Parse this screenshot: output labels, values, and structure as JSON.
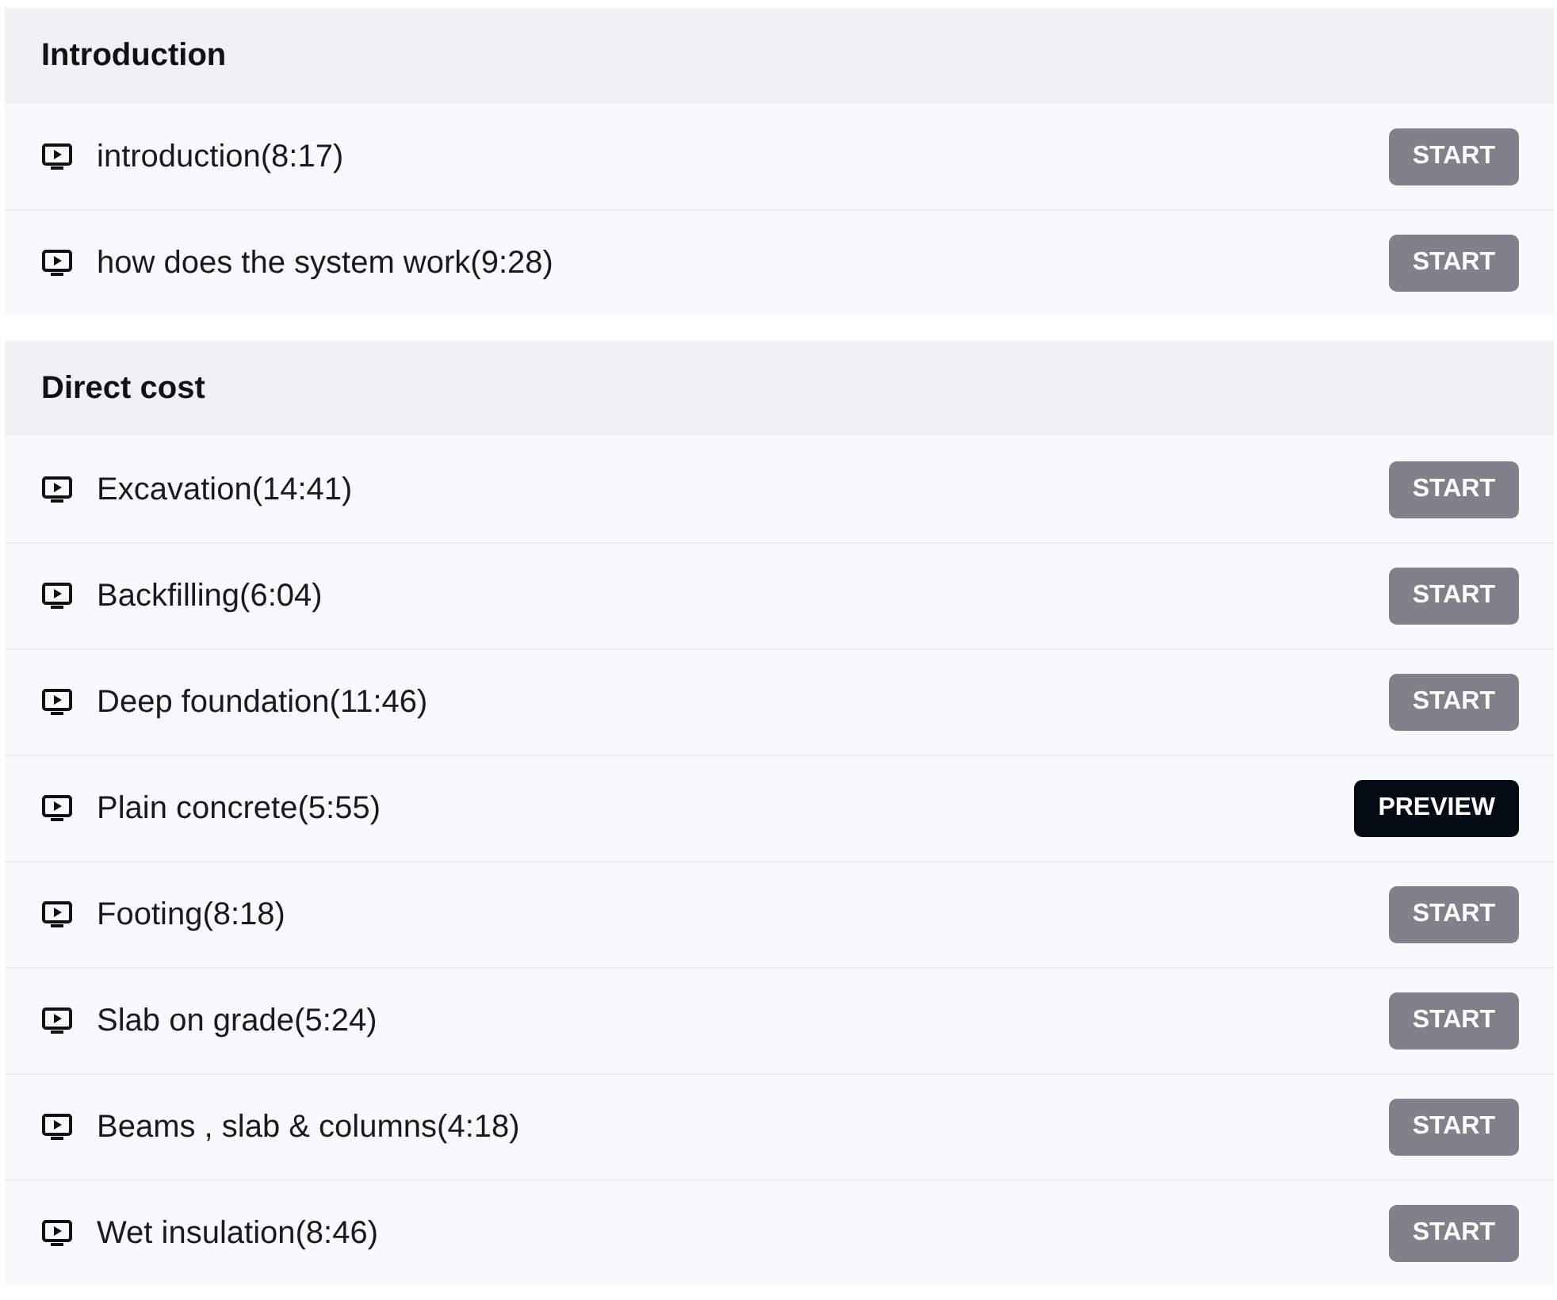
{
  "sections": [
    {
      "title": "Introduction",
      "lessons": [
        {
          "title": "introduction(8:17)",
          "action": {
            "kind": "start",
            "label": "START"
          }
        },
        {
          "title": "how does the system work(9:28)",
          "action": {
            "kind": "start",
            "label": "START"
          }
        }
      ]
    },
    {
      "title": "Direct cost",
      "lessons": [
        {
          "title": "Excavation(14:41)",
          "action": {
            "kind": "start",
            "label": "START"
          }
        },
        {
          "title": "Backfilling(6:04)",
          "action": {
            "kind": "start",
            "label": "START"
          }
        },
        {
          "title": "Deep foundation(11:46)",
          "action": {
            "kind": "start",
            "label": "START"
          }
        },
        {
          "title": "Plain concrete(5:55)",
          "action": {
            "kind": "preview",
            "label": "PREVIEW"
          }
        },
        {
          "title": "Footing(8:18)",
          "action": {
            "kind": "start",
            "label": "START"
          }
        },
        {
          "title": "Slab on grade(5:24)",
          "action": {
            "kind": "start",
            "label": "START"
          }
        },
        {
          "title": "Beams , slab & columns(4:18)",
          "action": {
            "kind": "start",
            "label": "START"
          }
        },
        {
          "title": "Wet insulation(8:46)",
          "action": {
            "kind": "start",
            "label": "START"
          }
        }
      ]
    }
  ]
}
